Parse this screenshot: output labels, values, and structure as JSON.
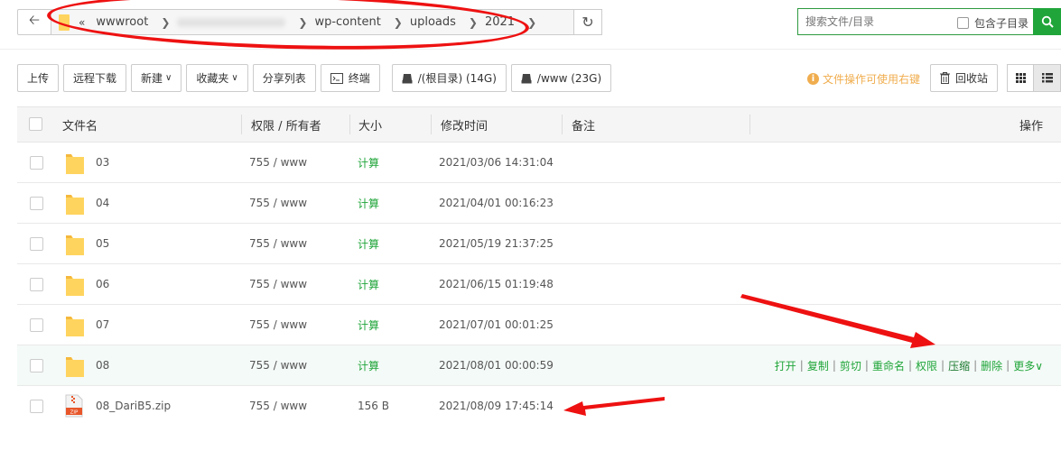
{
  "address": {
    "breadcrumbs": [
      "wwwroot",
      "wp-content",
      "uploads",
      "2021"
    ]
  },
  "search": {
    "placeholder": "搜索文件/目录",
    "include_sub_label": "包含子目录"
  },
  "toolbar": {
    "upload": "上传",
    "remote_download": "远程下载",
    "new": "新建",
    "favorites": "收藏夹",
    "share_list": "分享列表",
    "terminal": "终端",
    "disk_root": "/(根目录) (14G)",
    "disk_www": "/www (23G)",
    "hint": "文件操作可使用右键",
    "recycle_bin": "回收站"
  },
  "table": {
    "headers": {
      "name": "文件名",
      "permission": "权限 / 所有者",
      "size": "大小",
      "mtime": "修改时间",
      "remark": "备注",
      "ops": "操作"
    },
    "rows": [
      {
        "name": "03",
        "type": "folder",
        "perm": "755 / www",
        "size": "计算",
        "mtime": "2021/03/06 14:31:04"
      },
      {
        "name": "04",
        "type": "folder",
        "perm": "755 / www",
        "size": "计算",
        "mtime": "2021/04/01 00:16:23"
      },
      {
        "name": "05",
        "type": "folder",
        "perm": "755 / www",
        "size": "计算",
        "mtime": "2021/05/19 21:37:25"
      },
      {
        "name": "06",
        "type": "folder",
        "perm": "755 / www",
        "size": "计算",
        "mtime": "2021/06/15 01:19:48"
      },
      {
        "name": "07",
        "type": "folder",
        "perm": "755 / www",
        "size": "计算",
        "mtime": "2021/07/01 00:01:25"
      },
      {
        "name": "08",
        "type": "folder",
        "perm": "755 / www",
        "size": "计算",
        "mtime": "2021/08/01 00:00:59"
      },
      {
        "name": "08_DariB5.zip",
        "type": "zip",
        "perm": "755 / www",
        "size": "156 B",
        "mtime": "2021/08/09 17:45:14"
      }
    ],
    "row_ops": [
      "打开",
      "复制",
      "剪切",
      "重命名",
      "权限",
      "压缩",
      "删除",
      "更多"
    ]
  },
  "colors": {
    "accent": "#20a53a",
    "annotation": "#ee1111",
    "folder": "#ffd45e",
    "hint": "#f0ad4e"
  }
}
